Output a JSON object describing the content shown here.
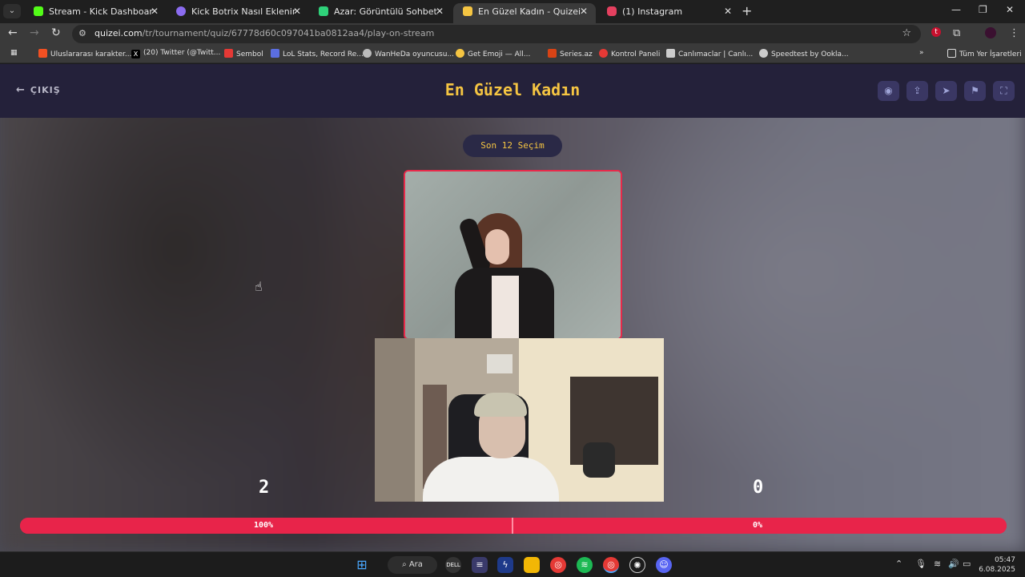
{
  "browser": {
    "tabs": [
      {
        "title": "Stream - Kick Dashboard",
        "favicon": "kick-icon",
        "color": "#53fc18"
      },
      {
        "title": "Kick Botrix Nasıl Eklenir? - İyi Sc",
        "favicon": "botrix-icon",
        "color": "#8b6cf0"
      },
      {
        "title": "Azar: Görüntülü Sohbet, Arkada",
        "favicon": "azar-icon",
        "color": "#2fd27a"
      },
      {
        "title": "En Güzel Kadın - Quizei",
        "favicon": "quizei-icon",
        "color": "#f5c542"
      },
      {
        "title": "(1) Instagram",
        "favicon": "instagram-icon",
        "color": "#e4405f"
      }
    ],
    "active_tab_index": 3,
    "url_host": "quizei.com",
    "url_path": "/tr/tournament/quiz/67778d60c097041ba0812aa4/play-on-stream",
    "bookmarks": [
      {
        "label": "Uluslararası karakter...",
        "color": "#f25022"
      },
      {
        "label": "(20) Twitter (@Twitt...",
        "color": "#000000"
      },
      {
        "label": "Sembol",
        "color": "#e53935"
      },
      {
        "label": "LoL Stats, Record Re...",
        "color": "#5b6ee1"
      },
      {
        "label": "WanHeDa oyuncusu...",
        "color": "#bbbbbb"
      },
      {
        "label": "Get Emoji — All...",
        "color": "#f5c542"
      },
      {
        "label": "Series.az",
        "color": "#d84315"
      },
      {
        "label": "Kontrol Paneli",
        "color": "#e53935"
      },
      {
        "label": "Canlımaclar | Canlı...",
        "color": "#cccccc"
      },
      {
        "label": "Speedtest by Ookla...",
        "color": "#cccccc"
      }
    ],
    "all_bookmarks_label": "Tüm Yer İşaretleri"
  },
  "quiz": {
    "exit_label": "ÇIKIŞ",
    "title": "En Güzel Kadın",
    "round_label": "Son 12 Seçim",
    "left_score": "2",
    "right_score": "0",
    "left_percent": "100%",
    "right_percent": "0%",
    "left_share": 1.0,
    "accent_color": "#f5c542",
    "bar_color": "#e8244a",
    "header_buttons": [
      "eye-icon",
      "share-icon",
      "send-icon",
      "flag-icon",
      "fullscreen-icon"
    ]
  },
  "taskbar": {
    "search_label": "Ara",
    "time": "05:47",
    "date": "6.08.2025"
  }
}
